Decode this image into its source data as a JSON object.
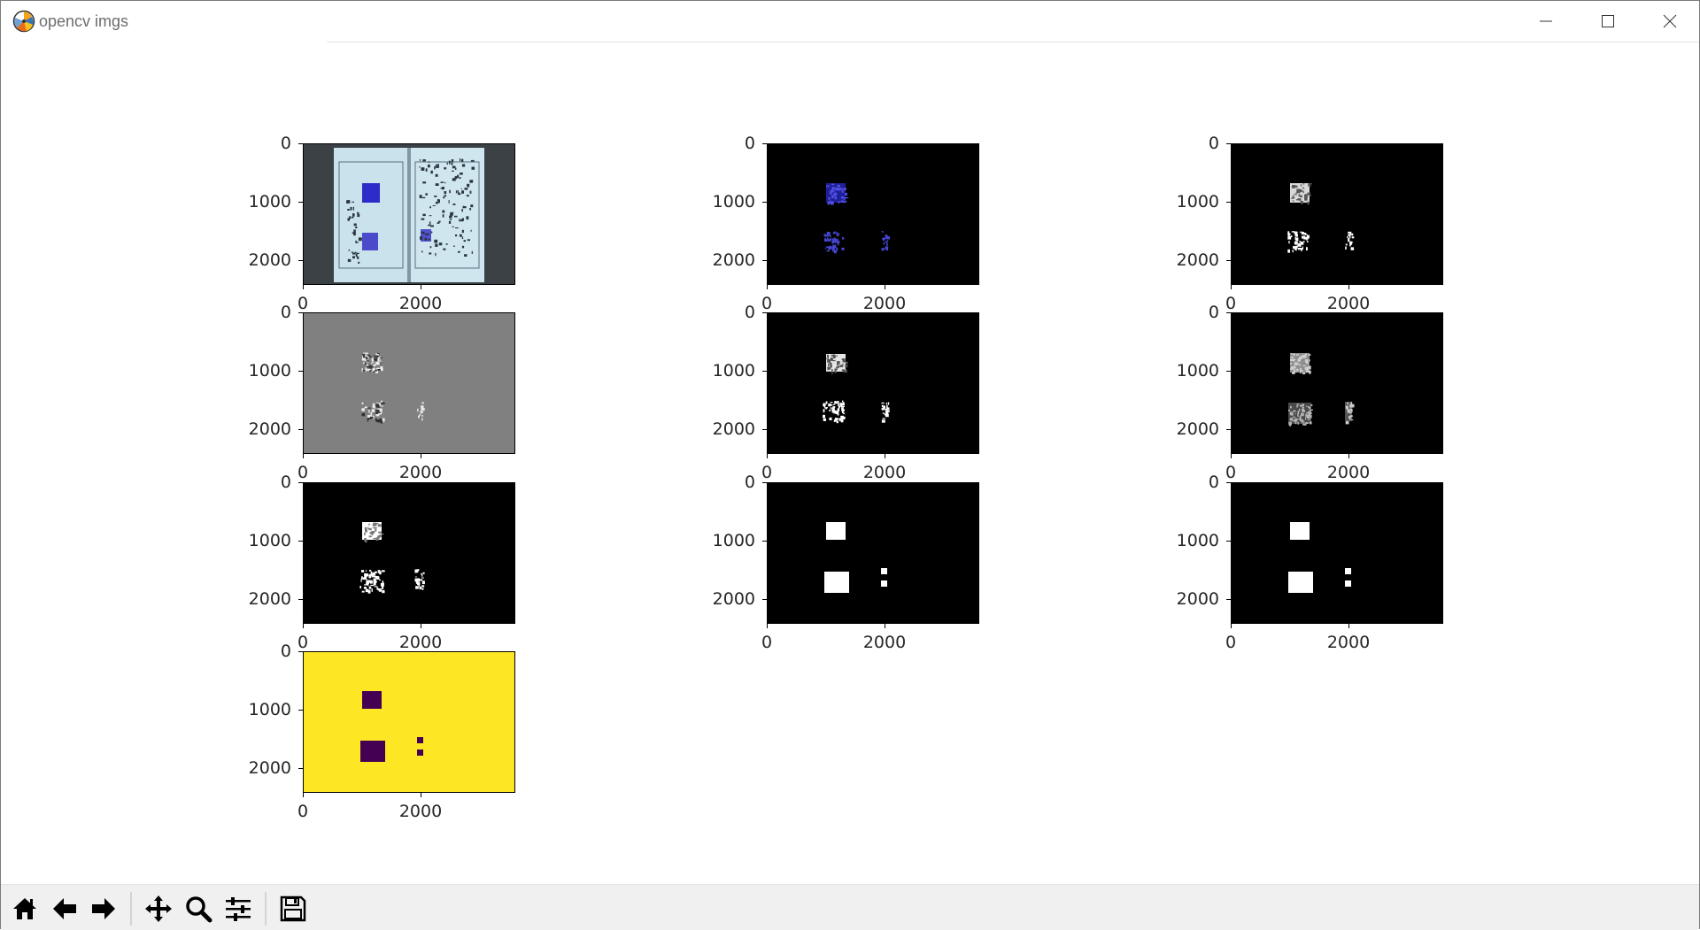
{
  "window": {
    "title": "opencv imgs",
    "app_icon": "matplotlib-icon",
    "controls": [
      "minimize-icon",
      "maximize-icon",
      "close-icon"
    ]
  },
  "figure": {
    "y_ticks": [
      "0",
      "1000",
      "2000"
    ],
    "x_ticks": [
      "0",
      "2000"
    ],
    "panels": [
      {
        "kind": "original-book-photo"
      },
      {
        "kind": "blue-channel-mask"
      },
      {
        "kind": "binary-mask"
      },
      {
        "kind": "gray-difference"
      },
      {
        "kind": "binary-mask"
      },
      {
        "kind": "grayscale-mask"
      },
      {
        "kind": "binary-mask"
      },
      {
        "kind": "dilated-mask"
      },
      {
        "kind": "dilated-mask"
      },
      {
        "kind": "viridis-inverted-mask"
      }
    ],
    "colors": {
      "viridis_yellow": "#fde725",
      "viridis_purple": "#440154",
      "gray_background": "#808080",
      "mask_background": "#000000",
      "stamp_blue": "#2c2cc8"
    }
  },
  "toolbar": {
    "buttons": [
      {
        "name": "home-button",
        "icon": "home-icon"
      },
      {
        "name": "back-button",
        "icon": "arrow-left-icon"
      },
      {
        "name": "forward-button",
        "icon": "arrow-right-icon"
      },
      {
        "name": "pan-button",
        "icon": "move-icon"
      },
      {
        "name": "zoom-button",
        "icon": "magnifier-icon"
      },
      {
        "name": "configure-subplots-button",
        "icon": "sliders-icon"
      },
      {
        "name": "save-button",
        "icon": "floppy-disk-icon"
      }
    ]
  }
}
